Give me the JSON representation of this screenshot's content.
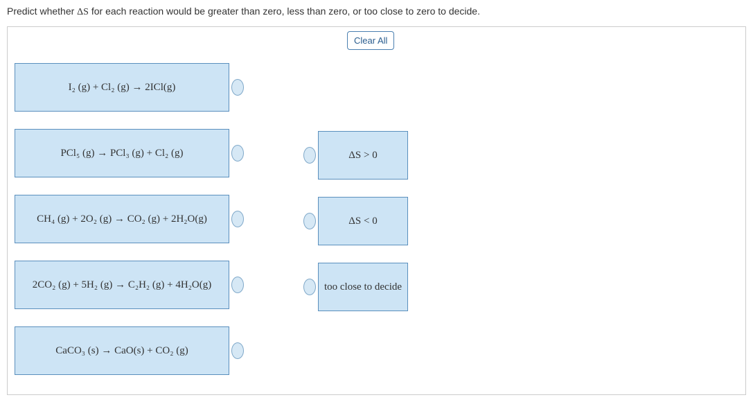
{
  "prompt_pre": "Predict whether ",
  "prompt_delta": "ΔS",
  "prompt_post": " for each reaction would be greater than zero, less than zero, or too close to zero to decide.",
  "clear_all": "Clear All",
  "reactions": [
    "I₂ (g) + Cl₂ (g) → 2ICl(g)",
    "PCl₅ (g) → PCl₃ (g) + Cl₂ (g)",
    "CH₄ (g) + 2O₂ (g) → CO₂ (g) + 2H₂O(g)",
    "2CO₂ (g) + 5H₂ (g) → C₂H₂ (g) + 4H₂O(g)",
    "CaCO₃ (s) → CaO(s) + CO₂ (g)"
  ],
  "categories": [
    "ΔS > 0",
    "ΔS < 0",
    "too close to decide"
  ],
  "chart_data": {
    "type": "table",
    "title": "Entropy change classification task",
    "rows": [
      {
        "reaction": "I2(g) + Cl2(g) -> 2ICl(g)",
        "delta_S": null
      },
      {
        "reaction": "PCl5(g) -> PCl3(g) + Cl2(g)",
        "delta_S": null
      },
      {
        "reaction": "CH4(g) + 2O2(g) -> CO2(g) + 2H2O(g)",
        "delta_S": null
      },
      {
        "reaction": "2CO2(g) + 5H2(g) -> C2H2(g) + 4H2O(g)",
        "delta_S": null
      },
      {
        "reaction": "CaCO3(s) -> CaO(s) + CO2(g)",
        "delta_S": null
      }
    ],
    "categories": [
      "ΔS > 0",
      "ΔS < 0",
      "too close to decide"
    ]
  }
}
